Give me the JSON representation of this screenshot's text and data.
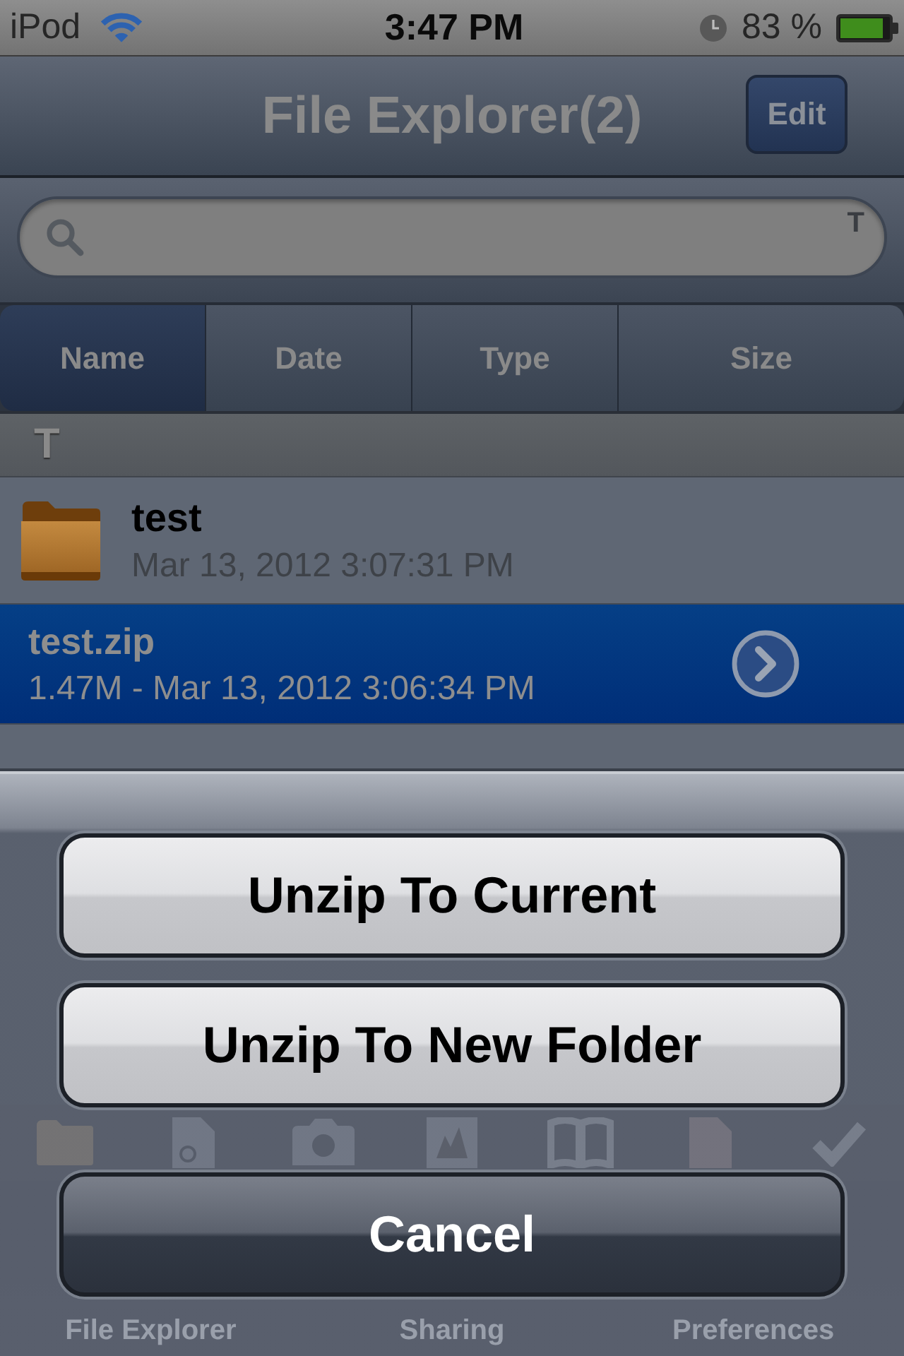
{
  "status_bar": {
    "carrier": "iPod",
    "time": "3:47 PM",
    "battery": "83 %"
  },
  "nav_bar": {
    "title": "File Explorer(2)",
    "edit_button": "Edit"
  },
  "search": {
    "section_index": [
      "T"
    ]
  },
  "sort_segments": [
    {
      "label": "Name",
      "selected": true
    },
    {
      "label": "Date",
      "selected": false
    },
    {
      "label": "Type",
      "selected": false
    },
    {
      "label": "Size",
      "selected": false
    }
  ],
  "sections": [
    {
      "header": "T",
      "rows": [
        {
          "kind": "folder",
          "name": "test",
          "detail": "Mar 13, 2012 3:07:31 PM",
          "selected": false
        },
        {
          "kind": "file",
          "name": "test.zip",
          "detail": "1.47M - Mar 13, 2012 3:06:34 PM",
          "selected": true
        }
      ]
    }
  ],
  "action_sheet": {
    "buttons": [
      {
        "label": "Unzip To Current",
        "kind": "default"
      },
      {
        "label": "Unzip To New Folder",
        "kind": "default"
      },
      {
        "label": "Cancel",
        "kind": "cancel"
      }
    ]
  },
  "tab_bar": {
    "tabs": [
      {
        "label": "File Explorer"
      },
      {
        "label": "Sharing"
      },
      {
        "label": "Preferences"
      }
    ]
  }
}
